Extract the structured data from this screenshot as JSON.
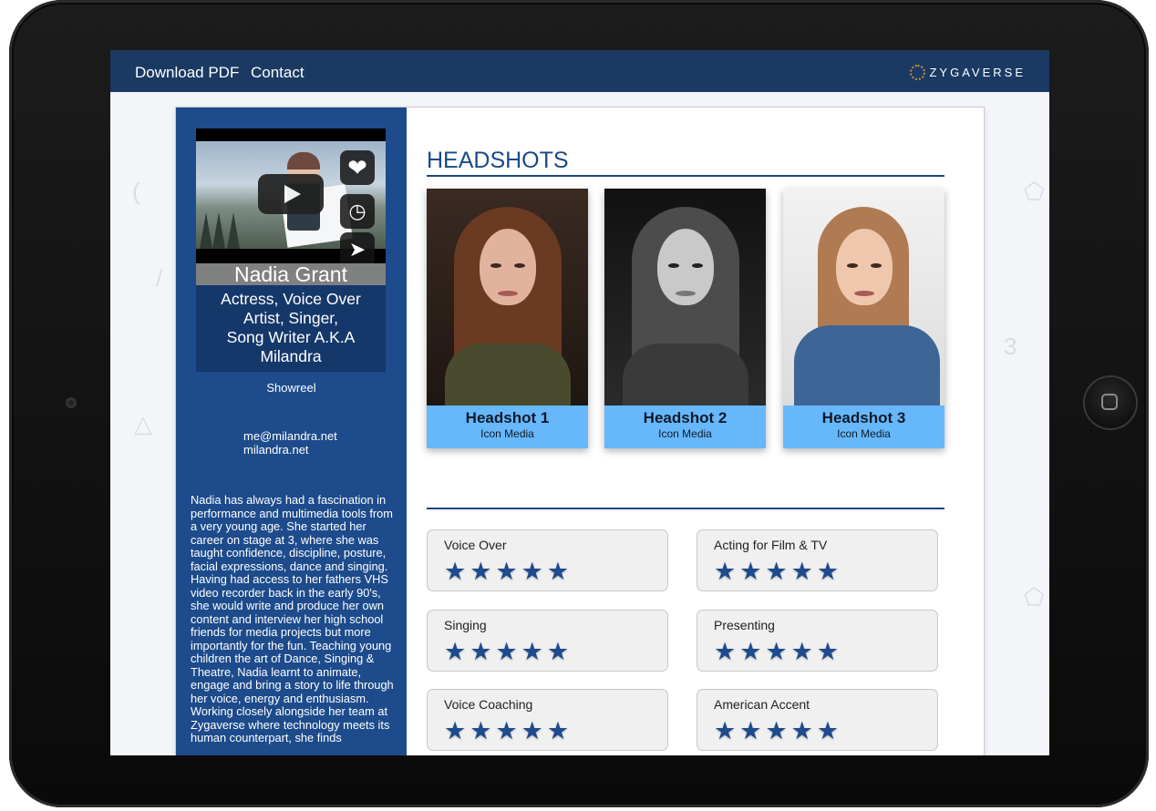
{
  "nav": {
    "download_pdf": "Download PDF",
    "contact": "Contact"
  },
  "brand": {
    "name": "ZYGAVERSE"
  },
  "profile": {
    "name": "Nadia Grant",
    "role_lines": [
      "Actress, Voice Over",
      "Artist, Singer,",
      "Song Writer A.K.A",
      "Milandra"
    ],
    "video_label": "Showreel",
    "email": "me@milandra.net",
    "website": "milandra.net",
    "bio": "Nadia has always had a fascination in performance and multimedia tools from a very young age. She started her career on stage at 3, where she was taught confidence, discipline, posture, facial expressions, dance and singing. Having had access to her fathers VHS video recorder back in the early 90's, she would write and produce her own content and interview her high school friends for media projects but more importantly for the fun. Teaching young children the art of Dance, Singing & Theatre, Nadia learnt to animate, engage and bring a story to life through her voice, energy and enthusiasm. Working closely alongside her team at Zygaverse where technology meets its human counterpart, she finds"
  },
  "video_icons": [
    "heart-icon",
    "clock-icon",
    "fullscreen-icon",
    "share-icon"
  ],
  "headshots": {
    "title": "HEADSHOTS",
    "items": [
      {
        "title": "Headshot 1",
        "credit": "Icon Media"
      },
      {
        "title": "Headshot 2",
        "credit": "Icon Media"
      },
      {
        "title": "Headshot 3",
        "credit": "Icon Media"
      }
    ]
  },
  "skills": [
    {
      "name": "Voice Over",
      "rating": 5
    },
    {
      "name": "Acting for Film & TV",
      "rating": 5
    },
    {
      "name": "Singing",
      "rating": 5
    },
    {
      "name": "Presenting",
      "rating": 5
    },
    {
      "name": "Voice Coaching",
      "rating": 5
    },
    {
      "name": "American Accent",
      "rating": 5
    }
  ],
  "colors": {
    "navbar": "#1a3a63",
    "sidebar": "#1d4b8c",
    "accent": "#1a4a86",
    "card": "#67b7fb",
    "star": "#1d4b8c"
  }
}
